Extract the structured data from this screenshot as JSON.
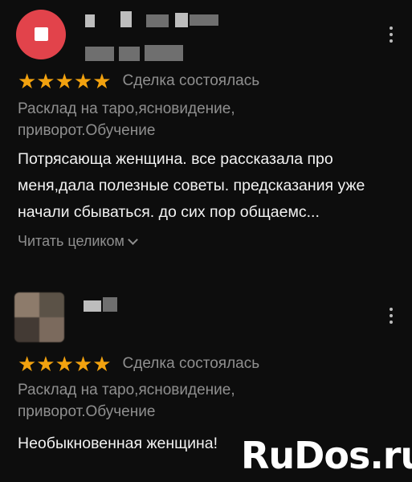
{
  "reviews": [
    {
      "rating": 5,
      "stars": "★★★★★",
      "deal_status": "Сделка состоялась",
      "service": "Расклад на таро,ясновидение, приворот.Обучение",
      "text": "Потрясающа женщина. все рассказала про меня,дала полезные советы. предсказания уже начали сбываться. до сих пор общаемс...",
      "read_more": "Читать целиком",
      "avatar_color": "#e2434b"
    },
    {
      "rating": 5,
      "stars": "★★★★★",
      "deal_status": "Сделка состоялась",
      "service": "Расклад на таро,ясновидение, приворот.Обучение",
      "text": "Необыкновенная женщина!"
    }
  ],
  "star_color": "#f2a20f",
  "watermark": "RuDos.ru"
}
